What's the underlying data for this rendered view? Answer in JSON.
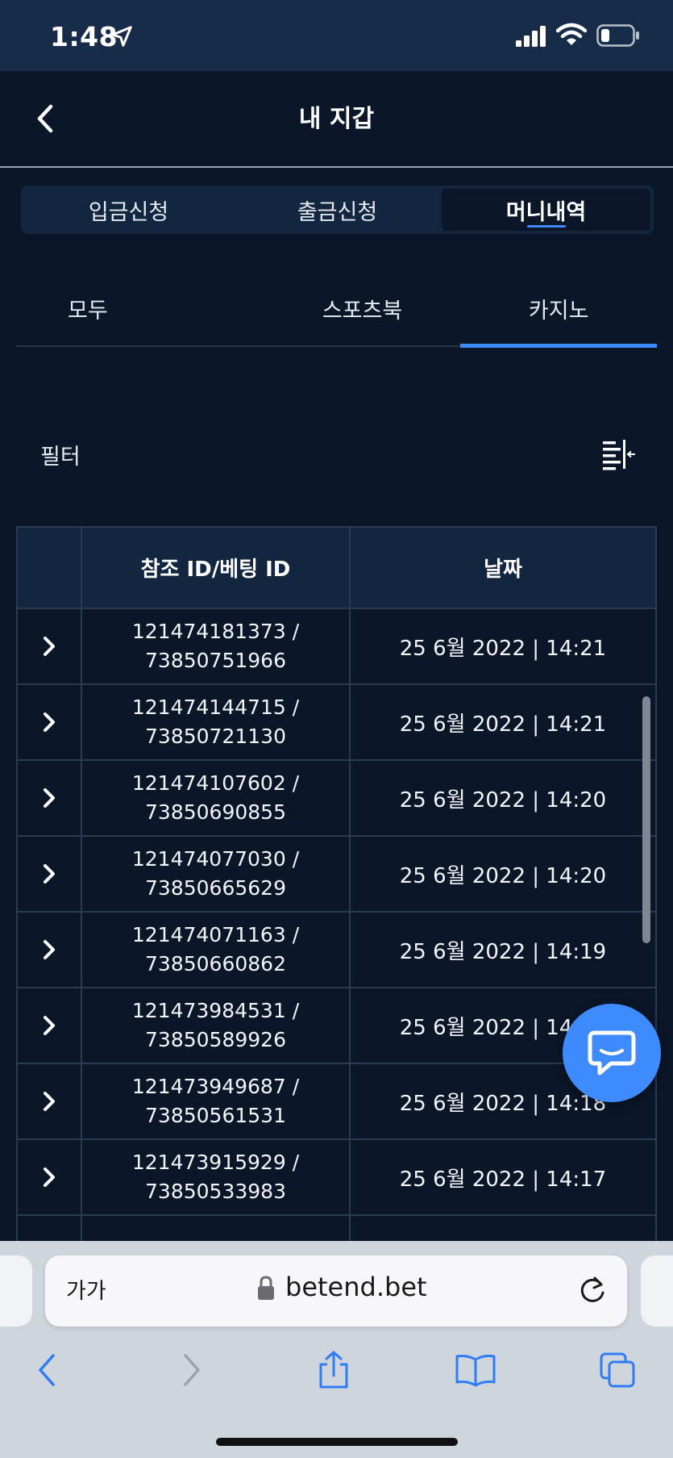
{
  "status_bar": {
    "time": "1:48"
  },
  "header": {
    "title": "내 지갑"
  },
  "main_tabs": [
    {
      "label": "입금신청"
    },
    {
      "label": "출금신청"
    },
    {
      "label": "머니내역"
    }
  ],
  "sub_tabs": [
    {
      "label": "모두"
    },
    {
      "label": "스포츠북"
    },
    {
      "label": "카지노"
    }
  ],
  "filter": {
    "label": "필터"
  },
  "table": {
    "columns": [
      "",
      "참조 ID/베팅 ID",
      "날짜"
    ],
    "rows": [
      {
        "ref_id": "121474181373 /",
        "bet_id": "73850751966",
        "date": "25 6월 2022 | 14:21"
      },
      {
        "ref_id": "121474144715 /",
        "bet_id": "73850721130",
        "date": "25 6월 2022 | 14:21"
      },
      {
        "ref_id": "121474107602 /",
        "bet_id": "73850690855",
        "date": "25 6월 2022 | 14:20"
      },
      {
        "ref_id": "121474077030 /",
        "bet_id": "73850665629",
        "date": "25 6월 2022 | 14:20"
      },
      {
        "ref_id": "121474071163 /",
        "bet_id": "73850660862",
        "date": "25 6월 2022 | 14:19"
      },
      {
        "ref_id": "121473984531 /",
        "bet_id": "73850589926",
        "date": "25 6월 2022 | 14:19"
      },
      {
        "ref_id": "121473949687 /",
        "bet_id": "73850561531",
        "date": "25 6월 2022 | 14:18"
      },
      {
        "ref_id": "121473915929 /",
        "bet_id": "73850533983",
        "date": "25 6월 2022 | 14:17"
      },
      {
        "ref_id": "",
        "bet_id": "",
        "date": ""
      }
    ]
  },
  "browser": {
    "text_size_label": "가가",
    "url": "betend.bet"
  },
  "colors": {
    "background": "#0b1628",
    "accent": "#3d8bff",
    "header_bg": "#132640"
  }
}
